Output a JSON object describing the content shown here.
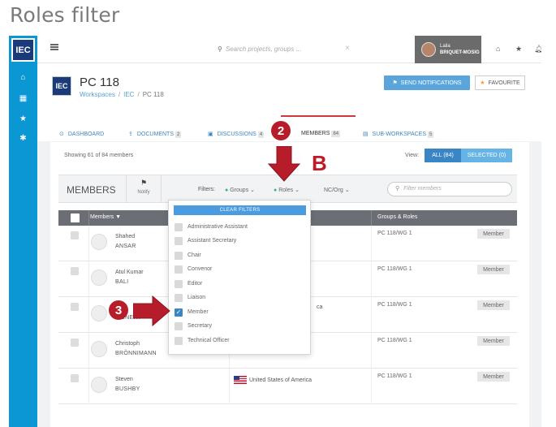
{
  "page": {
    "heading": "Roles filter"
  },
  "rail": {
    "logo": "IEC",
    "icons": [
      "home-icon",
      "calendar-icon",
      "star-icon",
      "gear-icon"
    ]
  },
  "topbar": {
    "search_placeholder": "Search projects, groups ...",
    "user": {
      "first": "Laila",
      "last": "BRIQUET-MOSIG"
    }
  },
  "project": {
    "logo": "IEC",
    "title": "PC 118",
    "breadcrumb": [
      "Workspaces",
      "IEC",
      "PC 118"
    ],
    "notify_button": "SEND NOTIFICATIONS",
    "favourite_button": "FAVOURITE"
  },
  "tabs": [
    {
      "label": "DASHBOARD",
      "badge": ""
    },
    {
      "label": "DOCUMENTS",
      "badge": "2"
    },
    {
      "label": "DISCUSSIONS",
      "badge": "4"
    },
    {
      "label": "MEMBERS",
      "badge": "84"
    },
    {
      "label": "SUB-WORKSPACES",
      "badge": "5"
    }
  ],
  "members": {
    "showing": "Showing 61 of 84 members",
    "view_label": "View:",
    "view_all": "ALL (84)",
    "view_selected": "SELECTED (0)",
    "title": "MEMBERS",
    "notify": "Notify",
    "filters_label": "Filters:",
    "filter_groups": "Groups",
    "filter_roles": "Roles",
    "filter_ncorg": "NC/Org",
    "filter_placeholder": "Filter members",
    "col_members": "Members ▼",
    "col_groups": "Groups & Roles",
    "rows": [
      {
        "first": "Shahed",
        "last": "ANSAR",
        "country": "",
        "group": "PC 118/WG 1",
        "role": "Member"
      },
      {
        "first": "Atul Kumar",
        "last": "BALI",
        "country": "",
        "group": "PC 118/WG 1",
        "role": "Member"
      },
      {
        "first": "",
        "last": "BIENERT",
        "country": "ca",
        "group": "PC 118/WG 1",
        "role": "Member"
      },
      {
        "first": "Christoph",
        "last": "BRÖNNIMANN",
        "country": "",
        "group": "PC 118/WG 1",
        "role": "Member"
      },
      {
        "first": "Steven",
        "last": "BUSHBY",
        "country": "United States of America",
        "group": "PC 118/WG 1",
        "role": "Member"
      }
    ]
  },
  "dropdown": {
    "clear": "CLEAR FILTERS",
    "options": [
      {
        "label": "Administrative Assistant",
        "checked": false
      },
      {
        "label": "Assistant Secretary",
        "checked": false
      },
      {
        "label": "Chair",
        "checked": false
      },
      {
        "label": "Convenor",
        "checked": false
      },
      {
        "label": "Editor",
        "checked": false
      },
      {
        "label": "Liaison",
        "checked": false
      },
      {
        "label": "Member",
        "checked": true
      },
      {
        "label": "Secretary",
        "checked": false
      },
      {
        "label": "Technical Officer",
        "checked": false
      }
    ]
  },
  "annotations": {
    "step2": "2",
    "step3": "3",
    "letter": "B",
    "color": "#c01a28"
  }
}
